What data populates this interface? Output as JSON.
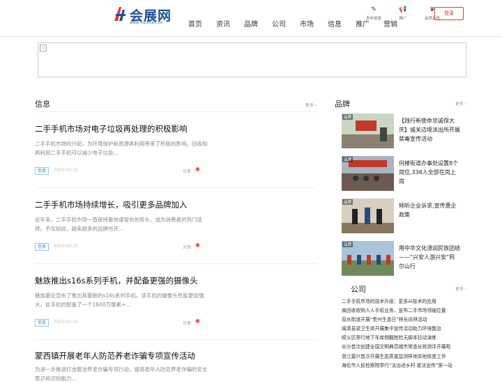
{
  "site": {
    "logo_text": "会展网",
    "logo_sub": "www.huizhan.cn"
  },
  "nav": [
    "首页",
    "资讯",
    "品牌",
    "公司",
    "市场",
    "信息",
    "推广",
    "营销"
  ],
  "tools": [
    {
      "icon": "edit-icon",
      "label": "发布信息"
    },
    {
      "icon": "megaphone-icon",
      "label": "推广"
    },
    {
      "icon": "member-icon",
      "label": "会员会员"
    }
  ],
  "login_label": "登录",
  "info_section": {
    "title": "信息",
    "more": "更多 ›",
    "articles": [
      {
        "title": "二手手机市场对电子垃圾再处理的积极影响",
        "summary": "二手手机市场的兴起，为环境保护和资源再利用带来了积极的影响。回收和再利用二手手机可以减少电子垃圾...",
        "tag": "信息",
        "date": "2023-03-15",
        "share": "分享:"
      },
      {
        "title": "二手手机市场持续增长，吸引更多品牌加入",
        "summary": "近年来，二手手机市场一直保持着快速增长的势头，成为消费者的热门选择。不仅如此，越来越多的品牌也开...",
        "tag": "信息",
        "date": "2023-03-15",
        "share": "分享:"
      },
      {
        "title": "魅族推出s16s系列手机，并配备更强的摄像头",
        "summary": "魅族最近宣布了推出其最新的s16s系列手机。该手机的摄像头性能更加强大，此手机的配备了一个1600万像素+...",
        "tag": "信息",
        "date": "2023-03-15",
        "share": "分享:"
      },
      {
        "title": "蒙西镇开展老年人防范养老诈骗专项宣传活动",
        "summary": "为进一步推进打击整治养老诈骗专项行动，提高老年人防范养老诈骗的安全意识和识别能力...",
        "tag": "信息",
        "date": "2023-03-15",
        "share": "分享:"
      }
    ]
  },
  "brand_section": {
    "title": "品牌",
    "more": "更多 ›",
    "items": [
      {
        "tag": "品牌",
        "text": "【践行新使命忠诚保大庆】城关边境派出所开展禁毒宣传活动",
        "color": "#8a6a4a"
      },
      {
        "tag": "品牌",
        "text": "何楼街道办事处设置8个岗位,336人全部在岗上岗",
        "color": "#4a6a8a"
      },
      {
        "tag": "品牌",
        "text": "倾听企业诉求,宣传惠企政策",
        "color": "#6a5a4a"
      },
      {
        "tag": "品牌",
        "text": "用中华文化浸润民族团结——“兴安人游兴安”阿尔山行",
        "color": "#5a7a5a"
      }
    ]
  },
  "company_section": {
    "title": "公司",
    "more": "更多 ›",
    "items": [
      "二手手机市场的技术升级：更多AI技术的应用",
      "扇回收收购人人手机业务，宣布二手市场领袖位置",
      "双水街道开展“贵州生态日”林长巡林活动",
      "闽清县梁卫生体开展集中宣传活动助力环境整治",
      "顺义区举行地下车库侧翻抢险无脚本拉动演练",
      "长沙首次创建全国文明典范城市常态长效测评开展啦",
      "浙江嘉兴首次开展生态质量监测样地实地核查工作",
      "海伦市人民检察院举行“法治进乡村·普法宣传”第一站"
    ]
  },
  "colors": {
    "accent": "#e33333",
    "brand_blue": "#1a4f9c",
    "tag_blue": "#3a7fc4"
  }
}
